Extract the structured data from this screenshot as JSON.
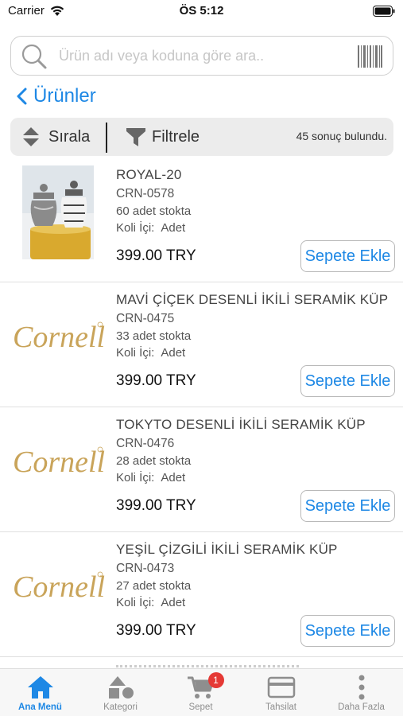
{
  "status_bar": {
    "carrier": "Carrier",
    "time": "ÖS 5:12"
  },
  "search": {
    "placeholder": "Ürün adı veya koduna göre ara..",
    "value": ""
  },
  "nav": {
    "back_label": "Ürünler"
  },
  "toolbar": {
    "sort_label": "Sırala",
    "filter_label": "Filtrele",
    "result_count": "45 sonuç bulundu."
  },
  "products": [
    {
      "name": "ROYAL-20",
      "code": "CRN-0578",
      "stock": "60 adet stokta",
      "pack_label": "Koli İçi:",
      "pack_value": "Adet",
      "price": "399.00 TRY",
      "image": "vase-photo",
      "add_label": "Sepete Ekle"
    },
    {
      "name": "MAVİ ÇİÇEK DESENLİ İKİLİ SERAMİK KÜP",
      "code": "CRN-0475",
      "stock": "33 adet stokta",
      "pack_label": "Koli İçi:",
      "pack_value": "Adet",
      "price": "399.00 TRY",
      "image": "cornella-logo",
      "logo_text": "Cornella",
      "add_label": "Sepete Ekle"
    },
    {
      "name": "TOKYTO DESENLİ İKİLİ SERAMİK KÜP",
      "code": "CRN-0476",
      "stock": "28 adet stokta",
      "pack_label": "Koli İçi:",
      "pack_value": "Adet",
      "price": "399.00 TRY",
      "image": "cornella-logo",
      "logo_text": "Cornella",
      "add_label": "Sepete Ekle"
    },
    {
      "name": "YEŞİL ÇİZGİLİ İKİLİ SERAMİK KÜP",
      "code": "CRN-0473",
      "stock": "27 adet stokta",
      "pack_label": "Koli İçi:",
      "pack_value": "Adet",
      "price": "399.00 TRY",
      "image": "cornella-logo",
      "logo_text": "Cornella",
      "add_label": "Sepete Ekle"
    }
  ],
  "tabs": [
    {
      "label": "Ana Menü",
      "icon": "home-icon",
      "active": true
    },
    {
      "label": "Kategori",
      "icon": "shapes-icon",
      "active": false
    },
    {
      "label": "Sepet",
      "icon": "cart-icon",
      "active": false,
      "badge": "1"
    },
    {
      "label": "Tahsilat",
      "icon": "card-icon",
      "active": false
    },
    {
      "label": "Daha Fazla",
      "icon": "more-icon",
      "active": false
    }
  ],
  "colors": {
    "accent": "#1e88e5",
    "badge": "#e53935",
    "logo_gold": "#c9a45a",
    "toolbar_bg": "#ececec"
  }
}
